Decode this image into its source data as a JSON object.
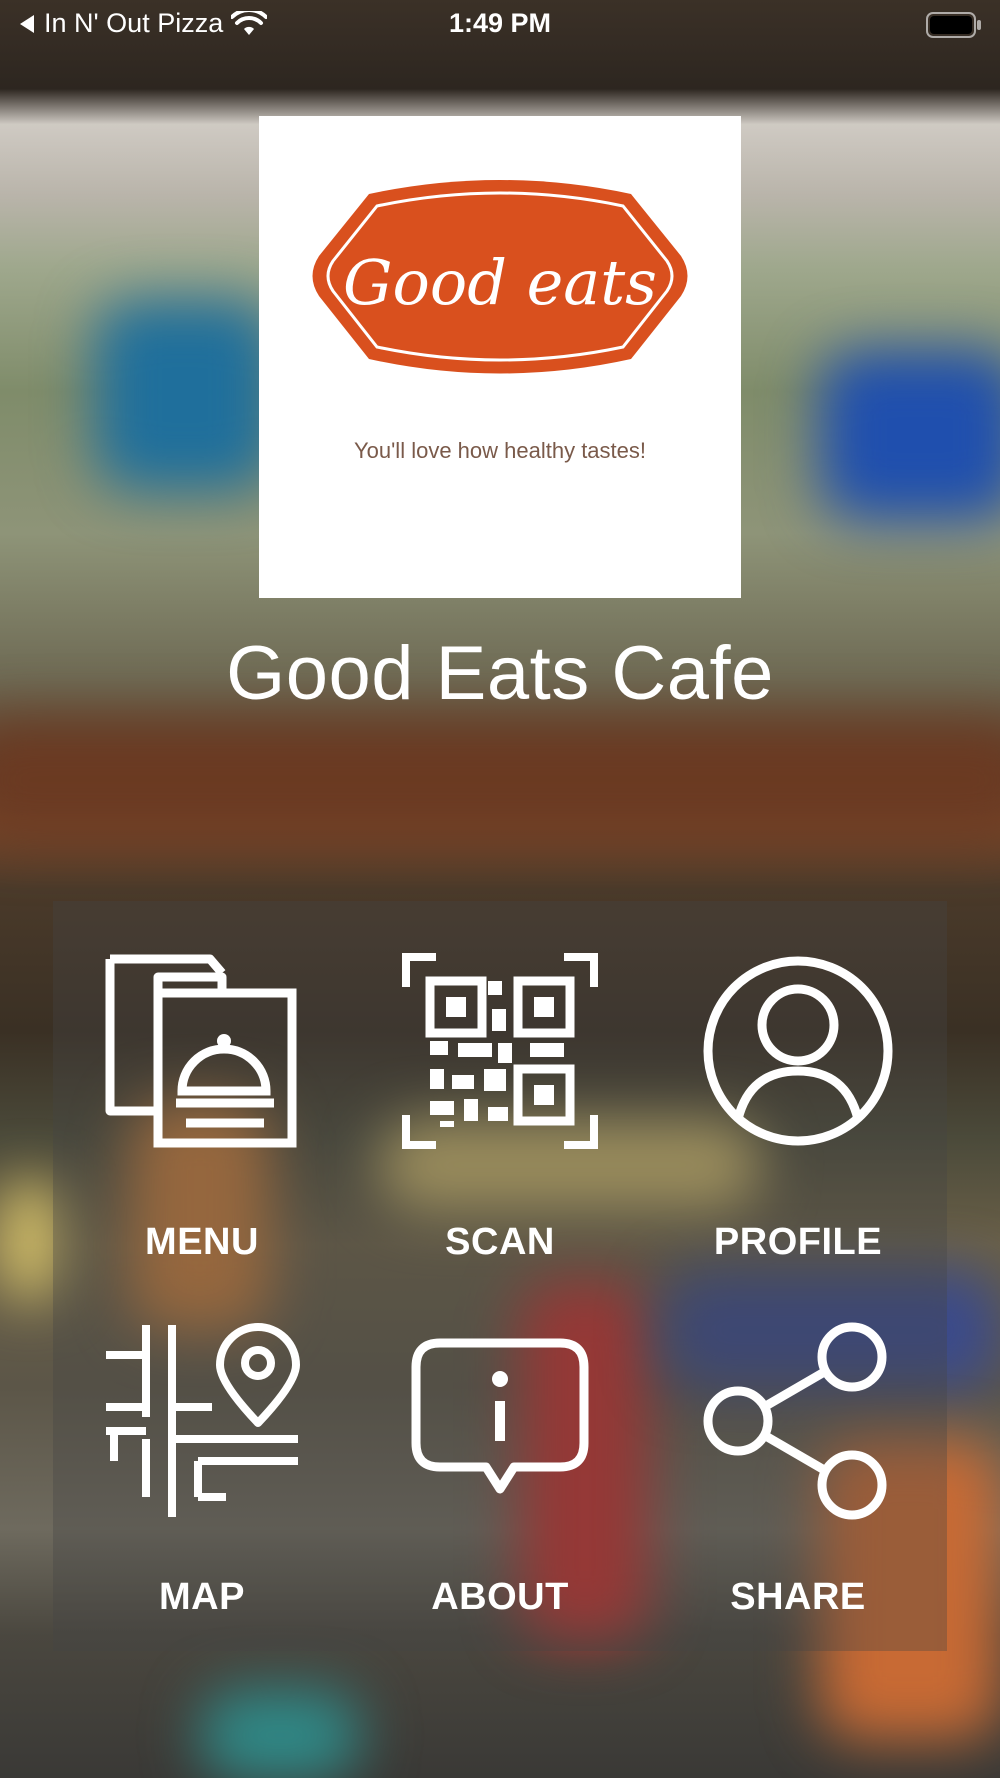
{
  "status_bar": {
    "back_label": "In N' Out Pizza",
    "time": "1:49 PM"
  },
  "logo": {
    "brand_text": "Good eats",
    "tagline": "You'll love how healthy tastes!",
    "brand_color": "#d9501e"
  },
  "app": {
    "title": "Good Eats Cafe"
  },
  "tiles": [
    {
      "label": "MENU",
      "icon": "menu-icon"
    },
    {
      "label": "SCAN",
      "icon": "qr-code-icon"
    },
    {
      "label": "PROFILE",
      "icon": "profile-icon"
    },
    {
      "label": "MAP",
      "icon": "map-icon"
    },
    {
      "label": "ABOUT",
      "icon": "info-icon"
    },
    {
      "label": "SHARE",
      "icon": "share-icon"
    }
  ]
}
